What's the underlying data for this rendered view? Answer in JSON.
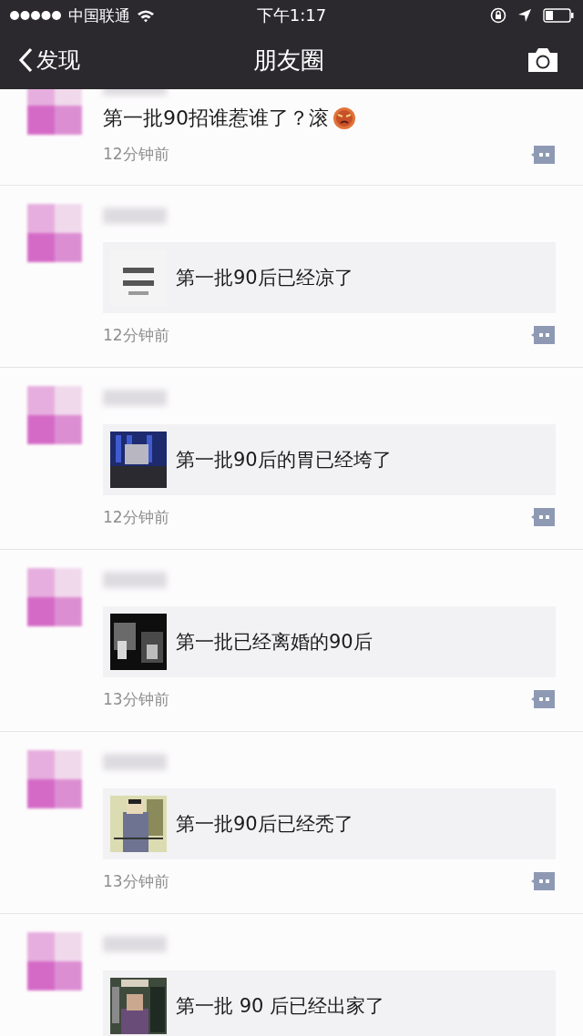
{
  "status_bar": {
    "carrier": "中国联通",
    "time": "下午1:17"
  },
  "nav": {
    "back_label": "发现",
    "title": "朋友圈"
  },
  "posts": [
    {
      "kind": "status",
      "text": "第一批90招谁惹谁了？滚",
      "emoji": true,
      "time": "12分钟前"
    },
    {
      "kind": "link",
      "card_title": "第一批90后已经凉了",
      "time": "12分钟前"
    },
    {
      "kind": "link",
      "card_title": "第一批90后的胃已经垮了",
      "time": "12分钟前"
    },
    {
      "kind": "link",
      "card_title": "第一批已经离婚的90后",
      "time": "13分钟前"
    },
    {
      "kind": "link",
      "card_title": "第一批90后已经秃了",
      "time": "13分钟前"
    },
    {
      "kind": "link",
      "card_title": "第一批 90 后已经出家了"
    }
  ]
}
